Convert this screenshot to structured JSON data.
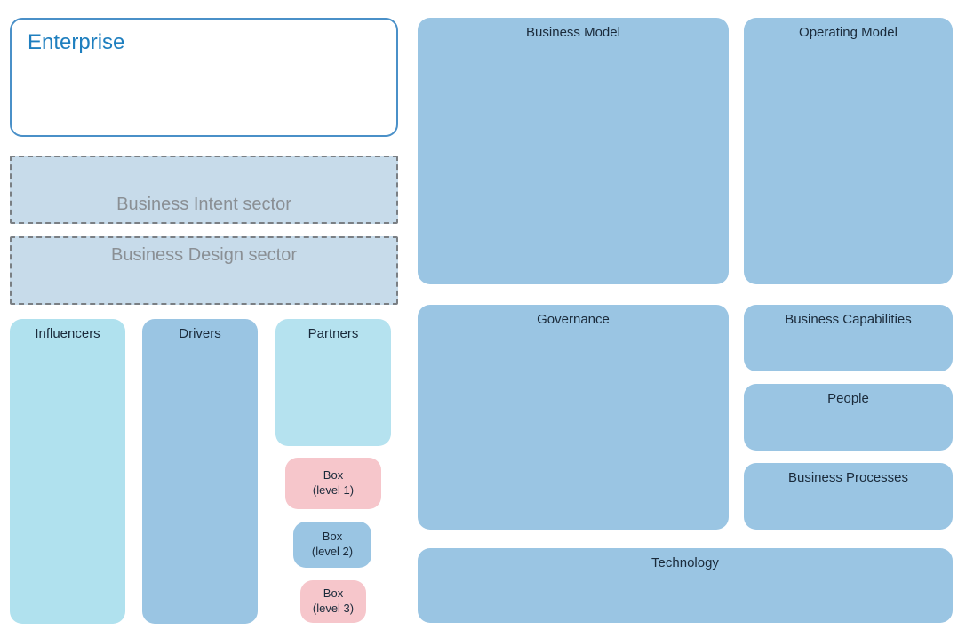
{
  "enterprise": {
    "title": "Enterprise"
  },
  "sectors": {
    "intent": "Business Intent sector",
    "design": "Business Design sector"
  },
  "left_blocks": {
    "influencers": "Influencers",
    "drivers": "Drivers",
    "partners": "Partners",
    "box1": "Box\n(level 1)",
    "box2": "Box\n(level 2)",
    "box3": "Box\n(level 3)"
  },
  "right_blocks": {
    "business_model": "Business Model",
    "operating_model": "Operating Model",
    "governance": "Governance",
    "business_capabilities": "Business Capabilities",
    "people": "People",
    "business_processes": "Business Processes",
    "technology": "Technology"
  },
  "colors": {
    "blue_border": "#4a90c8",
    "pale_blue": "#c7dbea",
    "light_aqua": "#b0e1ee",
    "light_aqua2": "#b5e2ef",
    "mid_blue": "#9ac5e3",
    "pink": "#f6c6cb"
  }
}
